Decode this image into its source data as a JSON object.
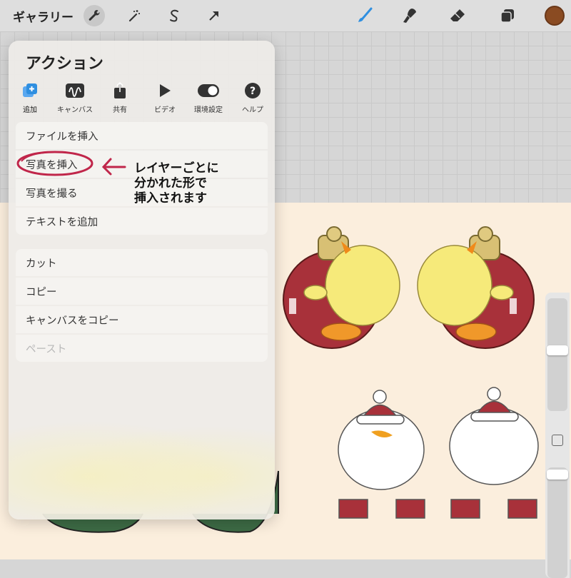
{
  "toolbar": {
    "gallery_label": "ギャラリー",
    "left_tools": [
      "wrench-icon",
      "magic-wand-icon",
      "selection-icon",
      "transform-arrow-icon"
    ],
    "right_tools": [
      "brush-icon",
      "smudge-icon",
      "eraser-icon",
      "layers-icon"
    ],
    "active_color": "#8a4b22",
    "brush_accent": "#2f8fe0"
  },
  "panel": {
    "title": "アクション",
    "tabs": [
      {
        "label": "追加",
        "icon": "add-layer-icon",
        "selected": true
      },
      {
        "label": "キャンバス",
        "icon": "canvas-wave-icon"
      },
      {
        "label": "共有",
        "icon": "share-icon"
      },
      {
        "label": "ビデオ",
        "icon": "play-icon"
      },
      {
        "label": "環境設定",
        "icon": "toggle-icon"
      },
      {
        "label": "ヘルプ",
        "icon": "help-icon"
      }
    ],
    "group1": [
      "ファイルを挿入",
      "写真を挿入",
      "写真を撮る",
      "テキストを追加"
    ],
    "group2": [
      "カット",
      "コピー",
      "キャンバスをコピー",
      "ペースト"
    ]
  },
  "annotation": {
    "line1": "レイヤーごとに",
    "line2": "分かれた形で",
    "line3": "挿入されます",
    "color": "#c0264a"
  }
}
